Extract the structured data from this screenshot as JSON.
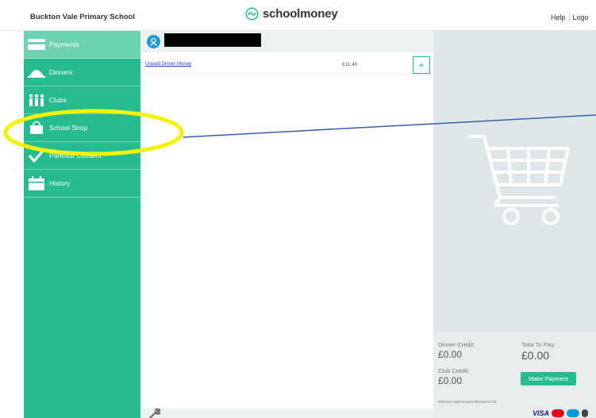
{
  "header": {
    "school_name": "Buckton Vale Primary School",
    "logo_text": "schoolmoney",
    "help_label": "Help",
    "logout_label": "Logo"
  },
  "sidebar": {
    "items": [
      {
        "label": "Payments",
        "icon": "card-icon",
        "active": true
      },
      {
        "label": "Dinners",
        "icon": "cloche-icon",
        "active": false
      },
      {
        "label": "Clubs",
        "icon": "people-icon",
        "active": false
      },
      {
        "label": "School Shop",
        "icon": "shopping-bag-icon",
        "active": false
      },
      {
        "label": "Parental Consent",
        "icon": "checkmark-icon",
        "active": false
      },
      {
        "label": "History",
        "icon": "calendar-icon",
        "active": false
      }
    ]
  },
  "payments": {
    "items": [
      {
        "name": "Unpaid Dinner Money",
        "price": "£11.40",
        "add_label": "+"
      }
    ]
  },
  "basket": {
    "dinner_credit_label": "Dinner Credit:",
    "dinner_credit_value": "£0.00",
    "club_credit_label": "Club Credit:",
    "club_credit_value": "£0.00",
    "total_label": "Total To Pay:",
    "total_value": "£0.00",
    "make_payment_label": "Make Payment",
    "min_note": "Minimum total amount allowed £1.00",
    "card_visa": "VISA"
  },
  "colors": {
    "brand_green": "#26bc8f",
    "active_green": "#6dd2ae",
    "annotation_yellow": "#f5f20a",
    "annotation_line": "#3a5fa8"
  }
}
